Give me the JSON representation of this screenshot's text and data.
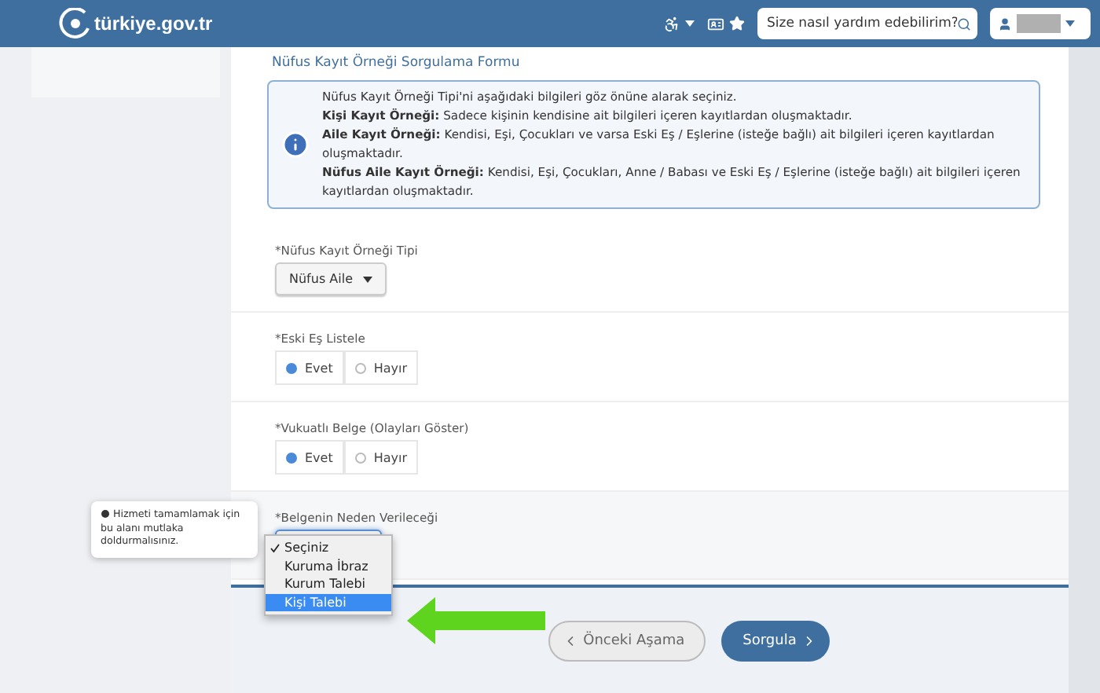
{
  "header": {
    "logo": "türkiye.gov.tr",
    "search": {
      "placeholder": "Size nasıl yardım edebilirim?"
    }
  },
  "form": {
    "title": "Nüfus Kayıt Örneği Sorgulama Formu",
    "info": [
      "Nüfus Kayıt Örneği Tipi'ni aşağıdaki bilgileri göz önüne alarak seçiniz.",
      "**Kişi Kayıt Örneği:** Sadece kişinin kendisine ait bilgileri içeren kayıtlardan oluşmaktadır.",
      "**Aile Kayıt Örneği:** Kendisi, Eşi, Çocukları ve varsa Eski Eş / Eşlerine (isteğe bağlı) ait bilgileri içeren kayıtlardan oluşmaktadır.",
      "**Nüfus Aile Kayıt Örneği:** Kendisi, Eşi, Çocukları, Anne / Babası ve Eski Eş / Eşlerine (isteğe bağlı) ait bilgileri içeren kayıtlardan oluşmaktadır."
    ],
    "fields": [
      {
        "kind": "select",
        "label": "*Nüfus Kayıt Örneği Tipi",
        "value": "Nüfus Aile",
        "open": false
      },
      {
        "kind": "radio",
        "label": "*Eski Eş Listele",
        "options": [
          {
            "label": "Evet",
            "selected": true
          },
          {
            "label": "Hayır",
            "selected": false
          }
        ]
      },
      {
        "kind": "radio",
        "label": "*Vukuatlı Belge (Olayları Göster)",
        "options": [
          {
            "label": "Evet",
            "selected": true
          },
          {
            "label": "Hayır",
            "selected": false
          }
        ]
      },
      {
        "kind": "select",
        "label": "*Belgenin Neden Verileceği",
        "open": true,
        "tooltip": "Hizmeti tamamlamak için bu alanı mutlaka doldurmalısınız.",
        "options": [
          {
            "label": "Seçiniz",
            "checked": true,
            "highlighted": false
          },
          {
            "label": "Kuruma İbraz",
            "checked": false,
            "highlighted": false
          },
          {
            "label": "Kurum Talebi",
            "checked": false,
            "highlighted": false
          },
          {
            "label": "Kişi Talebi",
            "checked": false,
            "highlighted": true
          }
        ]
      }
    ]
  },
  "buttons": {
    "back": "Önceki Aşama",
    "submit": "Sorgula"
  }
}
